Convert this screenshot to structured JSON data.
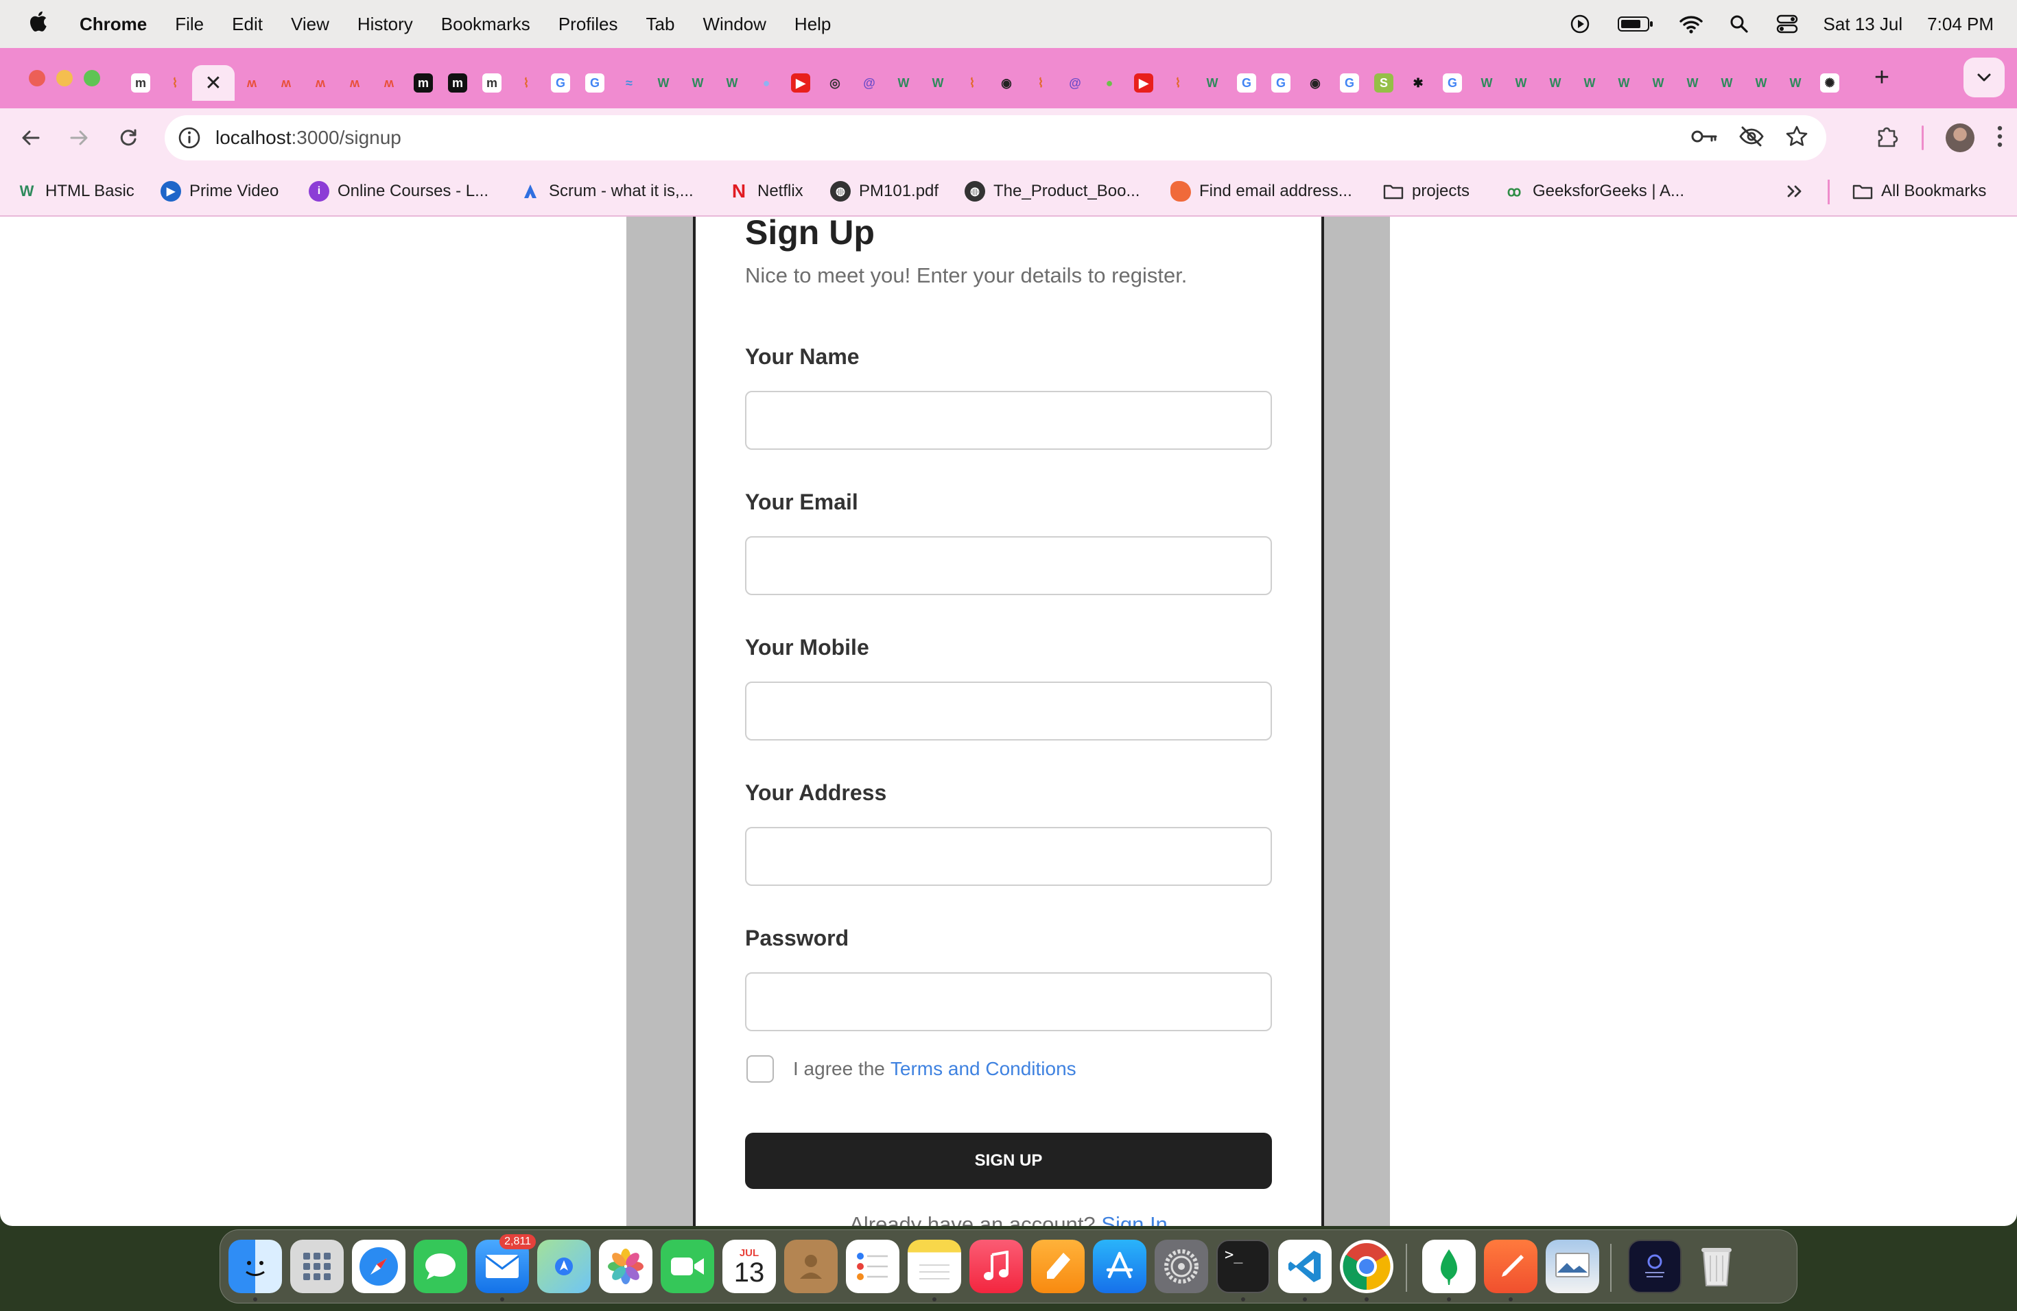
{
  "menubar": {
    "app": "Chrome",
    "items": [
      "File",
      "Edit",
      "View",
      "History",
      "Bookmarks",
      "Profiles",
      "Tab",
      "Window",
      "Help"
    ],
    "date": "Sat 13 Jul",
    "time": "7:04 PM"
  },
  "tabs": {
    "favicons": [
      "m",
      "flame",
      "x",
      "m-orange",
      "m-orange",
      "m-orange",
      "m-orange",
      "m-orange",
      "m-black",
      "m-black",
      "m",
      "flame",
      "google",
      "google",
      "wave",
      "webflow",
      "webflow",
      "webflow",
      "blue-dot",
      "youtube",
      "chromium",
      "threads",
      "webflow",
      "webflow",
      "flame",
      "github",
      "flame",
      "threads",
      "green-dot",
      "youtube",
      "flame",
      "webflow",
      "google",
      "google",
      "github",
      "google",
      "shopify",
      "asterisk",
      "google",
      "webflow",
      "webflow",
      "webflow",
      "webflow",
      "webflow",
      "webflow",
      "webflow",
      "webflow",
      "webflow",
      "webflow",
      "chatgpt"
    ],
    "active_index": 2
  },
  "address": {
    "host": "localhost",
    "path": ":3000/signup"
  },
  "bookmarks": [
    {
      "label": "HTML Basic",
      "icon": "webflow-icon"
    },
    {
      "label": "Prime Video",
      "icon": "prime-video-icon"
    },
    {
      "label": "Online Courses - L...",
      "icon": "info-circle-icon"
    },
    {
      "label": "Scrum - what it is,...",
      "icon": "atlassian-icon"
    },
    {
      "label": "Netflix",
      "icon": "netflix-icon"
    },
    {
      "label": "PM101.pdf",
      "icon": "globe-icon"
    },
    {
      "label": "The_Product_Boo...",
      "icon": "globe-icon"
    },
    {
      "label": "Find email address...",
      "icon": "hunter-icon"
    },
    {
      "label": "projects",
      "icon": "folder-icon"
    },
    {
      "label": "GeeksforGeeks | A...",
      "icon": "gfg-icon"
    }
  ],
  "all_bookmarks": "All Bookmarks",
  "form": {
    "title": "Sign Up",
    "subtitle": "Nice to meet you! Enter your details to register.",
    "fields": [
      {
        "label": "Your Name",
        "value": ""
      },
      {
        "label": "Your Email",
        "value": ""
      },
      {
        "label": "Your Mobile",
        "value": ""
      },
      {
        "label": "Your Address",
        "value": ""
      },
      {
        "label": "Password",
        "value": ""
      }
    ],
    "agree_text": "I agree the",
    "terms_link": "Terms and Conditions",
    "agree_checked": false,
    "submit": "SIGN UP",
    "already_text": "Already have an account?",
    "signin_link": "Sign In"
  },
  "dock": {
    "mail_badge": "2,811",
    "calendar_month": "JUL",
    "calendar_day": "13"
  },
  "colors": {
    "tabstrip": "#f08bd0",
    "toolbar": "#fbe6f4",
    "button": "#212121",
    "link": "#3f82e0"
  }
}
